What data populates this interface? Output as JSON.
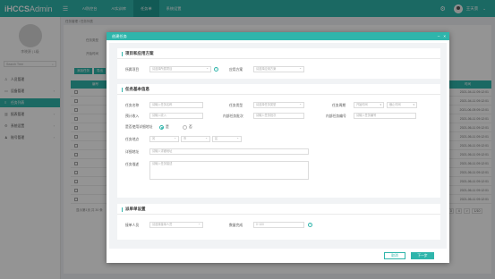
{
  "app": {
    "logo_prefix": "iHCCS",
    "logo_suffix": "Admin"
  },
  "topnav": [
    {
      "label": "AI防控台"
    },
    {
      "label": "AI实训库"
    },
    {
      "label": "任务单"
    },
    {
      "label": "系统设置"
    }
  ],
  "user": {
    "name": "王天景"
  },
  "sidebar": {
    "name": "李晓源 | 1级",
    "search_placeholder": "Search Tree",
    "items": [
      {
        "label": "人员管理",
        "icon": "user-icon",
        "has_arrow": false
      },
      {
        "label": "设备管理",
        "icon": "device-icon",
        "has_arrow": true
      },
      {
        "label": "任务列表",
        "icon": "list-icon",
        "has_arrow": false,
        "active": true
      },
      {
        "label": "报表管理",
        "icon": "chart-icon",
        "has_arrow": true
      },
      {
        "label": "系统设置",
        "icon": "gear-icon",
        "has_arrow": true
      },
      {
        "label": "账号管理",
        "icon": "account-icon",
        "has_arrow": true
      }
    ]
  },
  "background": {
    "breadcrumb": "任务管理 / 任务列表",
    "filter1": "任务类型",
    "filter2": "开始时间",
    "btn1": "添加任务",
    "btn2": "导出",
    "col_index": "编号",
    "col_time": "时间",
    "dates": [
      "2021-04-11 09:12:01",
      "2021-04-11 09:12:01",
      "2021-06-05 09:12:01",
      "2021-06-11 09:12:01",
      "2021-06-11 09:12:01",
      "2021-06-11 09:12:01",
      "2021-06-11 09:12:01",
      "2021-06-11 09:12:01",
      "2021-06-11 09:12:01",
      "2021-06-11 09:12:01",
      "2021-06-11 09:12:01",
      "2021-06-11 09:12:01",
      "2021-06-11 09:12:01"
    ],
    "total": "显示第1页 共 30 条",
    "pager": [
      "<",
      "1",
      "2",
      "3",
      "4",
      ">",
      "1/10"
    ]
  },
  "modal": {
    "title": "创建任务",
    "ctrl_min": "–",
    "ctrl_close": "×",
    "section1": {
      "title": "项目和应用方案",
      "project_label": "所属项目",
      "project_placeholder": "请选择所属项目",
      "plan_label": "应用方案",
      "plan_placeholder": "请选择应用方案"
    },
    "section2": {
      "title": "任务基本信息",
      "name_label": "任务名称",
      "name_placeholder": "请输入任务名称",
      "type_label": "任务类型",
      "type_placeholder": "请选择任务类型",
      "period_label": "任务周期",
      "start_placeholder": "开始时间",
      "end_placeholder": "截止时间",
      "budget_label": "预计收入",
      "budget_placeholder": "请输入收入",
      "batch_label": "内部任务批次",
      "batch_placeholder": "请输入任务批次",
      "number_label": "内部任务编号",
      "number_placeholder": "请输入任务编号",
      "map_label": "是否使用详细地址",
      "radio_yes": "是",
      "radio_no": "否",
      "location_label": "任务地点",
      "province_placeholder": "省",
      "city_placeholder": "市",
      "district_placeholder": "区",
      "address_label": "详细地址",
      "address_placeholder": "请输入详细地址",
      "desc_label": "任务描述",
      "desc_placeholder": "请输入任务描述"
    },
    "section3": {
      "title": "派单单设置",
      "assignee_label": "接单人员",
      "assignee_placeholder": "请选择接单人员",
      "quota_label": "数量完成",
      "quota_placeholder": "0~100"
    },
    "cancel_label": "取消",
    "next_label": "下一步"
  }
}
